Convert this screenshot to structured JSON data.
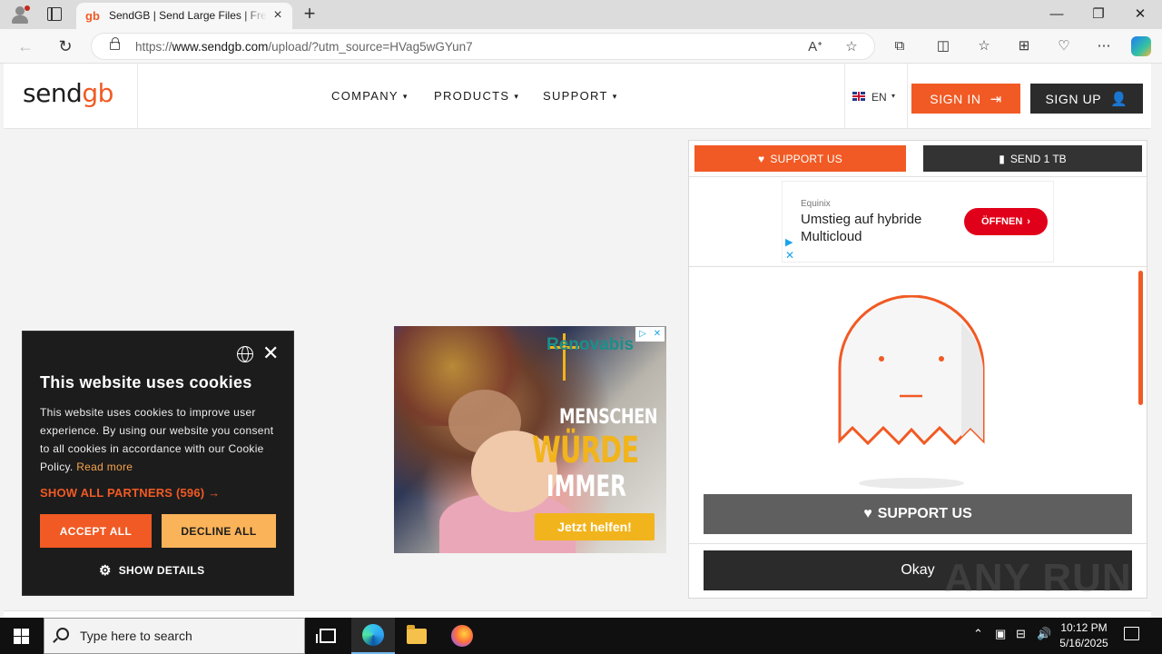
{
  "browser": {
    "tab_title": "SendGB | Send Large Files | Free f",
    "tab_favicon": "gb",
    "url_prefix": "https://",
    "url_domain": "www.sendgb.com",
    "url_path": "/upload/?utm_source=HVag5wGYun7",
    "window_controls": {
      "minimize": "—",
      "restore": "❐",
      "close": "✕"
    }
  },
  "site": {
    "logo_text": "send",
    "logo_accent": "gb",
    "menu": [
      {
        "label": "COMPANY"
      },
      {
        "label": "PRODUCTS"
      },
      {
        "label": "SUPPORT"
      }
    ],
    "language": "EN",
    "sign_in": "SIGN IN",
    "sign_up": "SIGN UP"
  },
  "panel": {
    "support_us_top": "SUPPORT US",
    "send_1tb": "SEND 1 TB",
    "ad_small": {
      "sponsor": "Equinix",
      "headline": "Umstieg auf hybride Multicloud",
      "cta": "ÖFFNEN"
    },
    "support_us_big": "SUPPORT US",
    "okay": "Okay"
  },
  "ad_large": {
    "brand": "Renovabis",
    "line1": "MENSCHEN",
    "line2": "WÜRDE",
    "line3": "IMMER",
    "cta": "Jetzt helfen!"
  },
  "cookie": {
    "title": "This website uses cookies",
    "body": "This website uses cookies to improve user experience. By using our website you consent to all cookies in accordance with our Cookie Policy.",
    "read_more": "Read more",
    "partners": "SHOW ALL PARTNERS (596) →",
    "accept": "ACCEPT ALL",
    "decline": "DECLINE ALL",
    "details": "SHOW DETAILS"
  },
  "watermark": "ANY RUN",
  "taskbar": {
    "search_placeholder": "Type here to search",
    "time": "10:12 PM",
    "date": "5/16/2025"
  },
  "colors": {
    "brand_orange": "#f15a24",
    "dark": "#2b2b2b",
    "decline_yellow": "#fbb35a"
  }
}
